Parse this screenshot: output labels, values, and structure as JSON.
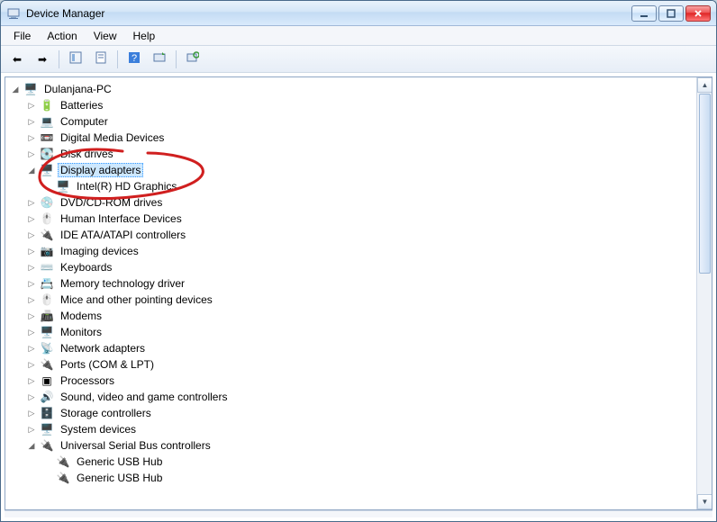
{
  "window": {
    "title": "Device Manager"
  },
  "menu": {
    "file": "File",
    "action": "Action",
    "view": "View",
    "help": "Help"
  },
  "tree": {
    "root": "Dulanjana-PC",
    "items": [
      {
        "label": "Batteries",
        "icon": "🔋",
        "expanded": false
      },
      {
        "label": "Computer",
        "icon": "💻",
        "expanded": false
      },
      {
        "label": "Digital Media Devices",
        "icon": "📼",
        "expanded": false
      },
      {
        "label": "Disk drives",
        "icon": "💽",
        "expanded": false
      },
      {
        "label": "Display adapters",
        "icon": "🖥️",
        "expanded": true,
        "selected": true,
        "children": [
          {
            "label": "Intel(R) HD Graphics",
            "icon": "🖥️"
          }
        ]
      },
      {
        "label": "DVD/CD-ROM drives",
        "icon": "💿",
        "expanded": false
      },
      {
        "label": "Human Interface Devices",
        "icon": "🖱️",
        "expanded": false
      },
      {
        "label": "IDE ATA/ATAPI controllers",
        "icon": "🔌",
        "expanded": false
      },
      {
        "label": "Imaging devices",
        "icon": "📷",
        "expanded": false
      },
      {
        "label": "Keyboards",
        "icon": "⌨️",
        "expanded": false
      },
      {
        "label": "Memory technology driver",
        "icon": "📇",
        "expanded": false
      },
      {
        "label": "Mice and other pointing devices",
        "icon": "🖱️",
        "expanded": false
      },
      {
        "label": "Modems",
        "icon": "📠",
        "expanded": false
      },
      {
        "label": "Monitors",
        "icon": "🖥️",
        "expanded": false
      },
      {
        "label": "Network adapters",
        "icon": "📡",
        "expanded": false
      },
      {
        "label": "Ports (COM & LPT)",
        "icon": "🔌",
        "expanded": false
      },
      {
        "label": "Processors",
        "icon": "▣",
        "expanded": false
      },
      {
        "label": "Sound, video and game controllers",
        "icon": "🔊",
        "expanded": false
      },
      {
        "label": "Storage controllers",
        "icon": "🗄️",
        "expanded": false
      },
      {
        "label": "System devices",
        "icon": "🖥️",
        "expanded": false
      },
      {
        "label": "Universal Serial Bus controllers",
        "icon": "🔌",
        "expanded": true,
        "children": [
          {
            "label": "Generic USB Hub",
            "icon": "🔌"
          },
          {
            "label": "Generic USB Hub",
            "icon": "🔌"
          }
        ]
      }
    ]
  },
  "annotation": {
    "color": "#d01f1f"
  }
}
